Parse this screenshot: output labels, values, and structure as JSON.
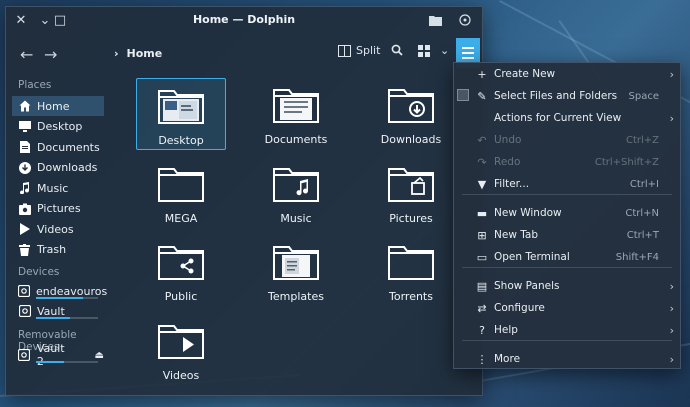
{
  "window": {
    "title": "Home — Dolphin",
    "close_glyph": "✕",
    "minimize_glyph": "⌄",
    "maximize_glyph": "□"
  },
  "toolbar": {
    "breadcrumb": "Home",
    "split_label": "Split"
  },
  "sidebar": {
    "places_title": "Places",
    "places": [
      {
        "label": "Home",
        "icon": "home-icon",
        "active": true
      },
      {
        "label": "Desktop",
        "icon": "desktop-icon"
      },
      {
        "label": "Documents",
        "icon": "documents-icon"
      },
      {
        "label": "Downloads",
        "icon": "downloads-icon"
      },
      {
        "label": "Music",
        "icon": "music-icon"
      },
      {
        "label": "Pictures",
        "icon": "pictures-icon"
      },
      {
        "label": "Videos",
        "icon": "videos-icon"
      },
      {
        "label": "Trash",
        "icon": "trash-icon"
      }
    ],
    "devices_title": "Devices",
    "devices": [
      {
        "label": "endeavouros",
        "usage": 0.75
      },
      {
        "label": "Vault",
        "usage": 0.55
      }
    ],
    "removable_title": "Removable Devices",
    "removable": [
      {
        "label": "Vault 2",
        "usage": 0.45
      }
    ]
  },
  "files": [
    {
      "label": "Desktop",
      "icon": "desktop-folder-icon",
      "selected": true
    },
    {
      "label": "Documents",
      "icon": "documents-folder-icon"
    },
    {
      "label": "Downloads",
      "icon": "downloads-folder-icon"
    },
    {
      "label": "MEGA",
      "icon": "folder-icon"
    },
    {
      "label": "Music",
      "icon": "music-folder-icon"
    },
    {
      "label": "Pictures",
      "icon": "pictures-folder-icon"
    },
    {
      "label": "Public",
      "icon": "public-folder-icon"
    },
    {
      "label": "Templates",
      "icon": "templates-folder-icon"
    },
    {
      "label": "Torrents",
      "icon": "folder-icon"
    },
    {
      "label": "Videos",
      "icon": "videos-folder-icon"
    }
  ],
  "menu": {
    "items": [
      {
        "label": "Create New",
        "icon": "plus-icon",
        "shortcut": "",
        "submenu": true
      },
      {
        "label": "Select Files and Folders",
        "icon": "select-icon",
        "shortcut": "Space"
      },
      {
        "label": "Actions for Current View",
        "icon": "",
        "shortcut": "",
        "submenu": true
      },
      {
        "label": "Undo",
        "icon": "undo-icon",
        "shortcut": "Ctrl+Z",
        "disabled": true
      },
      {
        "label": "Redo",
        "icon": "redo-icon",
        "shortcut": "Ctrl+Shift+Z",
        "disabled": true
      },
      {
        "label": "Filter...",
        "icon": "filter-icon",
        "shortcut": "Ctrl+I"
      },
      {
        "label": "New Window",
        "icon": "new-window-icon",
        "shortcut": "Ctrl+N"
      },
      {
        "label": "New Tab",
        "icon": "new-tab-icon",
        "shortcut": "Ctrl+T"
      },
      {
        "label": "Open Terminal",
        "icon": "terminal-icon",
        "shortcut": "Shift+F4"
      },
      {
        "label": "Show Panels",
        "icon": "panels-icon",
        "shortcut": "",
        "submenu": true
      },
      {
        "label": "Configure",
        "icon": "configure-icon",
        "shortcut": "",
        "submenu": true
      },
      {
        "label": "Help",
        "icon": "help-icon",
        "shortcut": "",
        "submenu": true
      },
      {
        "label": "More",
        "icon": "more-icon",
        "shortcut": "",
        "submenu": true
      }
    ]
  },
  "colors": {
    "accent": "#3daee9",
    "window_bg": "#202c3a",
    "menu_bg": "#24303e"
  }
}
